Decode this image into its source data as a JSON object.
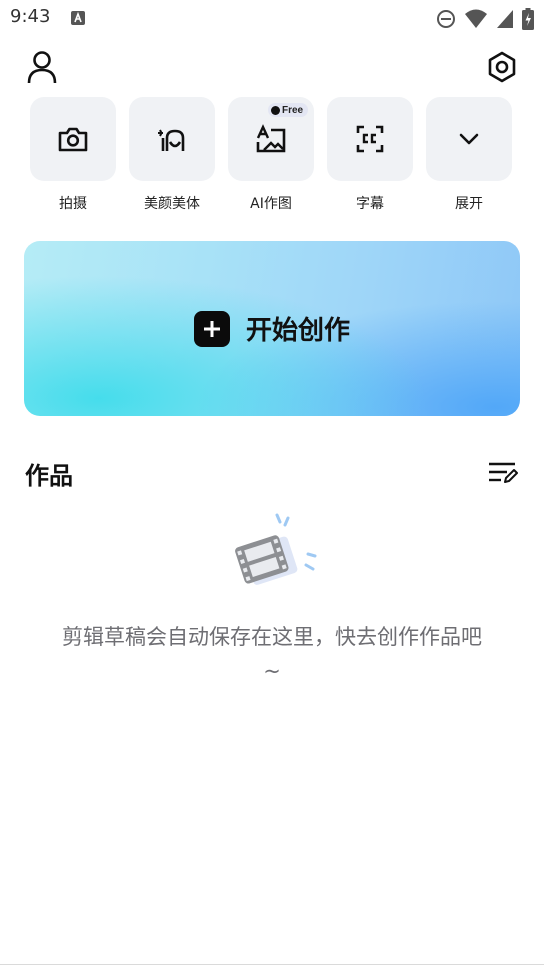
{
  "status_bar": {
    "time": "9:43"
  },
  "tools": [
    {
      "label": "拍摄",
      "icon": "camera-icon"
    },
    {
      "label": "美颜美体",
      "icon": "beauty-icon"
    },
    {
      "label": "AI作图",
      "icon": "ai-image-icon",
      "badge": "Free"
    },
    {
      "label": "字幕",
      "icon": "captions-icon"
    },
    {
      "label": "展开",
      "icon": "chevron-down-icon"
    }
  ],
  "create": {
    "label": "开始创作"
  },
  "works": {
    "title": "作品",
    "empty_text": "剪辑草稿会自动保存在这里，快去创作作品吧~"
  },
  "colors": {
    "tile_bg": "#f0f2f5",
    "card_cyan": "#40dceb",
    "card_blue": "#4fa6f8",
    "empty_text": "#6e6e73"
  }
}
